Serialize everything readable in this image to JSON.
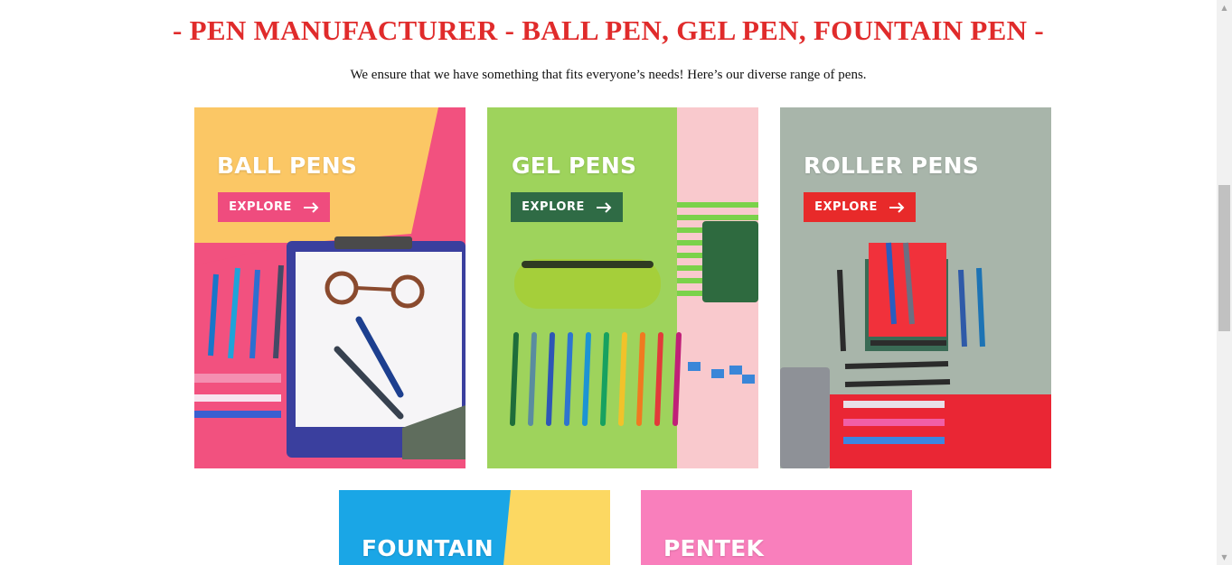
{
  "heading": "- PEN MANUFACTURER - BALL PEN, GEL PEN, FOUNTAIN PEN -",
  "subtext": "We ensure that we have something that fits everyone’s needs! Here’s our diverse range of pens.",
  "cards": [
    {
      "title": "BALL PENS",
      "button": "EXPLORE",
      "button_color": "#ef4c7e"
    },
    {
      "title": "GEL PENS",
      "button": "EXPLORE",
      "button_color": "#2f6b45"
    },
    {
      "title": "ROLLER PENS",
      "button": "EXPLORE",
      "button_color": "#e82a2a"
    },
    {
      "title": "FOUNTAIN"
    },
    {
      "title": "PENTEK"
    }
  ],
  "colors": {
    "heading": "#e02b2b",
    "ball_bg_yellow": "#fbc765",
    "ball_bg_pink": "#f2517f",
    "gel_bg_green": "#9ed35c",
    "gel_bg_pink": "#f9c9cd",
    "roller_bg_grey": "#a8b5aa",
    "roller_bg_red": "#ea2634",
    "fountain_bg_blue": "#1aa6e6",
    "fountain_bg_yellow": "#fcd862",
    "pentek_bg_pink": "#f97fbc"
  },
  "icons": [
    "arrow-right-icon",
    "chevron-up-icon",
    "chevron-down-icon"
  ]
}
